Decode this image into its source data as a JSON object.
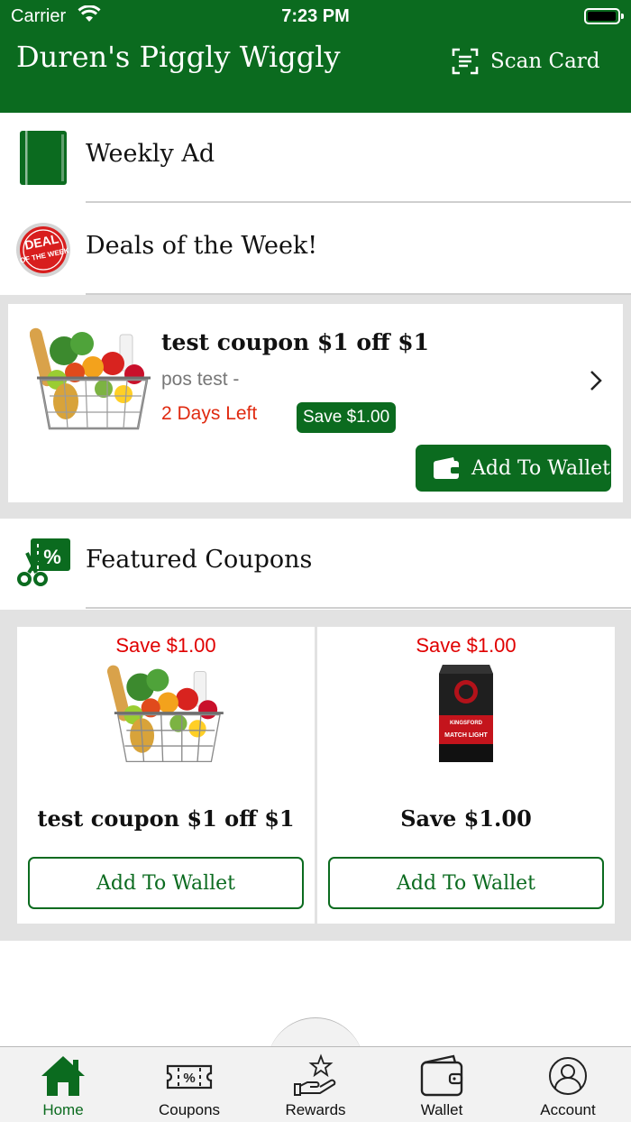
{
  "status_bar": {
    "carrier": "Carrier",
    "time": "7:23 PM"
  },
  "header": {
    "title": "Duren's Piggly Wiggly",
    "scan_label": "Scan Card"
  },
  "rows": {
    "weekly_ad": "Weekly Ad",
    "deals": "Deals of the Week!",
    "featured": "Featured Coupons"
  },
  "deal_badge": {
    "line1": "DEAL",
    "line2": "OF THE WEEK"
  },
  "deal": {
    "title": "test coupon $1 off $1",
    "subtitle": "pos test -",
    "days_left": "2 Days Left",
    "save": "Save $1.00",
    "wallet_label": "Add To Wallet"
  },
  "featured_coupons": [
    {
      "save": "Save $1.00",
      "title": "test coupon $1 off $1",
      "button": "Add To Wallet"
    },
    {
      "save": "Save $1.00",
      "title": "Save $1.00",
      "button": "Add To Wallet"
    }
  ],
  "product_bag": {
    "brand": "KINGSFORD",
    "label": "MATCH LIGHT"
  },
  "tabs": [
    {
      "label": "Home",
      "active": true
    },
    {
      "label": "Coupons"
    },
    {
      "label": "Rewards"
    },
    {
      "label": "Wallet"
    },
    {
      "label": "Account"
    }
  ],
  "colors": {
    "brand_green": "#0b6b1f",
    "alert_red": "#e02a10",
    "save_red": "#e00000"
  }
}
